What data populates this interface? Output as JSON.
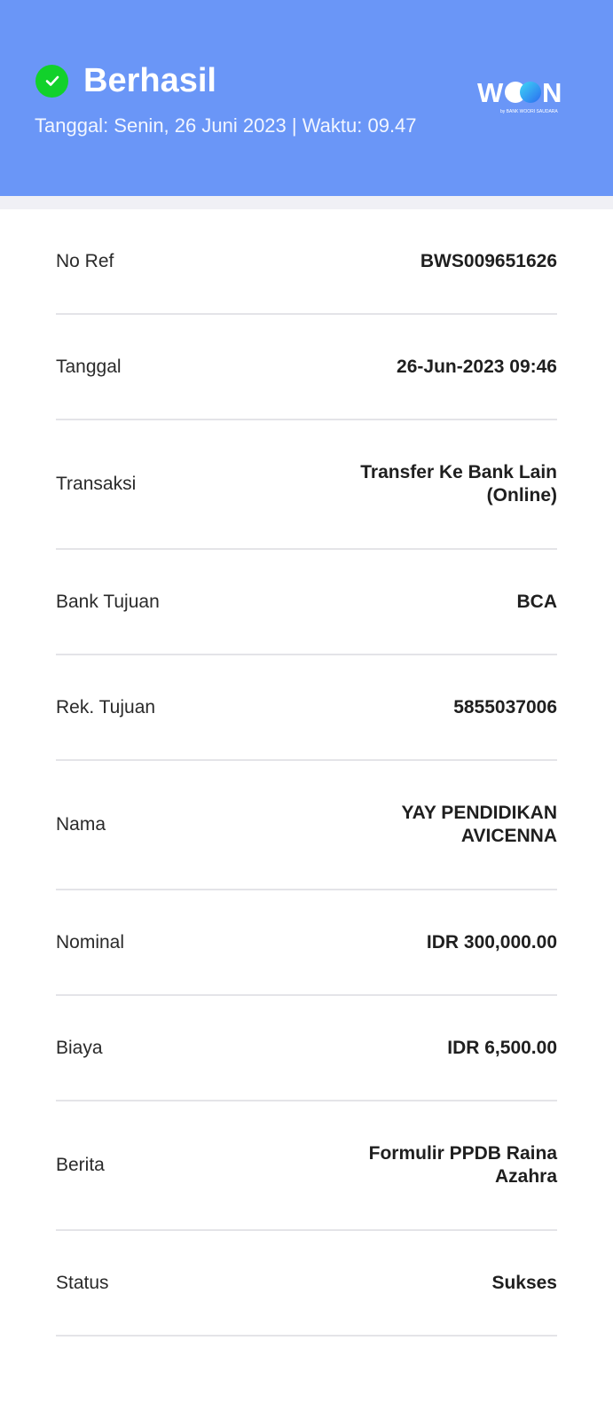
{
  "header": {
    "status": "Berhasil",
    "datetime": "Tanggal: Senin, 26 Juni 2023 | Waktu: 09.47",
    "logo_text": "WOON",
    "logo_subtext": "by BANK WOORI SAUDARA",
    "check_icon": "check-icon",
    "background_color": "#6a96f7",
    "success_color": "#12d12b"
  },
  "details": [
    {
      "label": "No Ref",
      "value": "BWS009651626"
    },
    {
      "label": "Tanggal",
      "value": "26-Jun-2023 09:46"
    },
    {
      "label": "Transaksi",
      "value": "Transfer Ke Bank Lain\n(Online)"
    },
    {
      "label": "Bank Tujuan",
      "value": "BCA"
    },
    {
      "label": "Rek. Tujuan",
      "value": "5855037006"
    },
    {
      "label": "Nama",
      "value": "YAY PENDIDIKAN\nAVICENNA"
    },
    {
      "label": "Nominal",
      "value": "IDR 300,000.00"
    },
    {
      "label": "Biaya",
      "value": "IDR 6,500.00"
    },
    {
      "label": "Berita",
      "value": "Formulir PPDB  Raina\nAzahra"
    },
    {
      "label": "Status",
      "value": "Sukses"
    }
  ]
}
